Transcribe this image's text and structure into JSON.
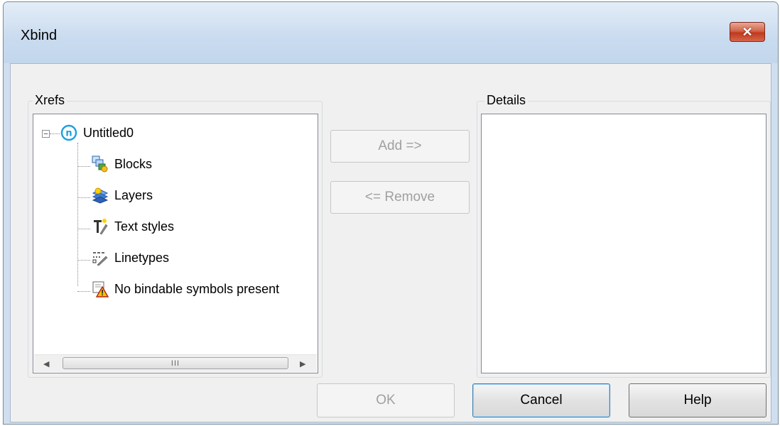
{
  "window": {
    "title": "Xbind",
    "close_glyph": "✕"
  },
  "xrefs": {
    "label": "Xrefs",
    "root": {
      "label": "Untitled0",
      "expander": "−",
      "icon": "drawing-icon"
    },
    "children": [
      {
        "label": "Blocks",
        "icon": "blocks-icon"
      },
      {
        "label": "Layers",
        "icon": "layers-icon"
      },
      {
        "label": "Text styles",
        "icon": "text-styles-icon"
      },
      {
        "label": "Linetypes",
        "icon": "linetypes-icon"
      },
      {
        "label": "No bindable symbols present",
        "icon": "warning-icon"
      }
    ],
    "scrollbar": {
      "left": "◀",
      "right": "▶",
      "grip": "III"
    }
  },
  "actions": {
    "add": "Add =>",
    "remove": "<= Remove"
  },
  "details": {
    "label": "Details"
  },
  "footer": {
    "ok": "OK",
    "cancel": "Cancel",
    "help": "Help"
  },
  "colors": {
    "accent": "#1a9fe0",
    "close": "#c0391c",
    "warning": "#e8b400"
  }
}
